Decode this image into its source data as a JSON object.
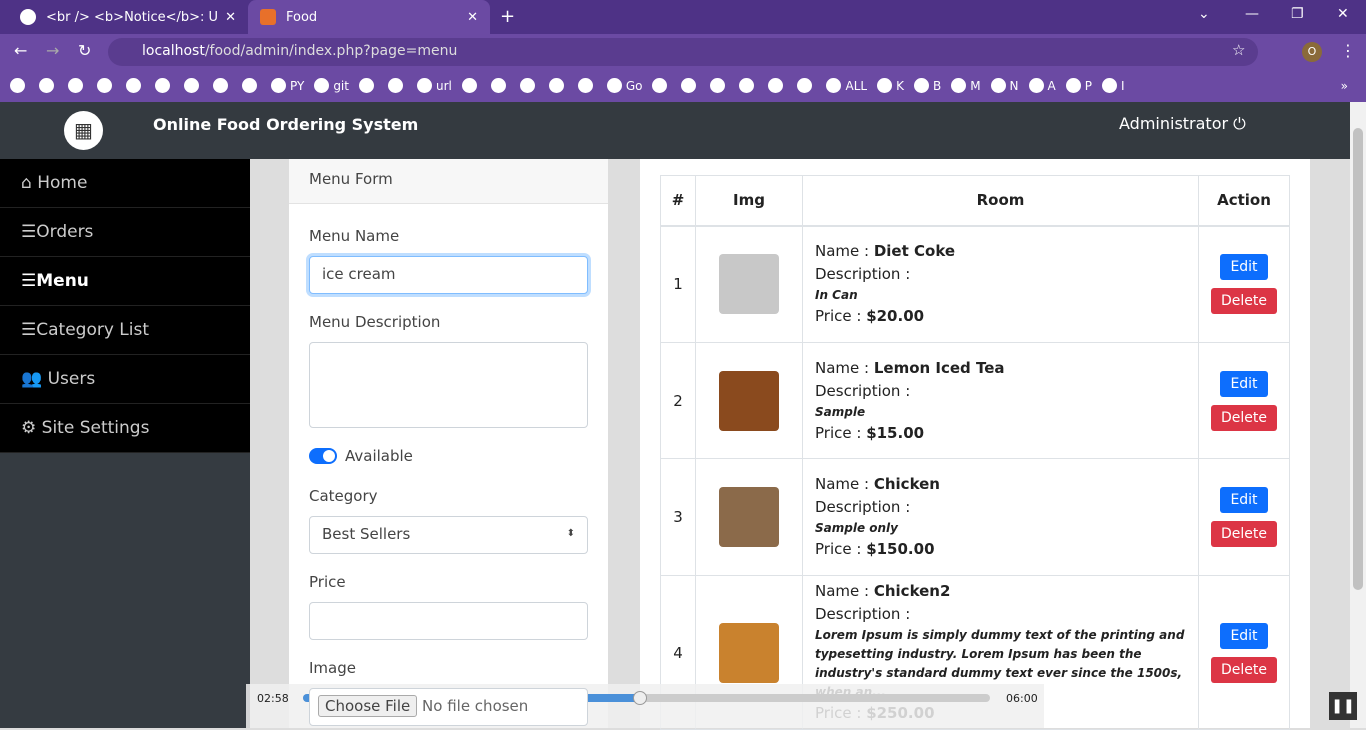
{
  "browser": {
    "tabs": [
      {
        "title": "<br /> <b>Notice</b>: Undefined",
        "icon": "globe-icon"
      },
      {
        "title": "Food",
        "icon": "xampp-icon",
        "active": true
      }
    ],
    "url_host": "localhost",
    "url_path": "/food/admin/index.php?page=menu",
    "bookmarks": [
      "",
      "",
      "",
      "",
      "",
      "",
      "",
      "",
      "",
      "PY",
      "git",
      "",
      "",
      "url",
      "",
      "",
      "",
      "",
      "",
      "Go",
      "",
      "",
      "",
      "",
      "",
      "",
      "ALL",
      "K",
      "B",
      "M",
      "N",
      "A",
      "P",
      "I"
    ]
  },
  "app": {
    "title": "Online Food Ordering System",
    "user": "Administrator"
  },
  "sidebar": {
    "items": [
      {
        "label": "Home",
        "icon": "home-icon"
      },
      {
        "label": "Orders",
        "icon": "list-icon"
      },
      {
        "label": "Menu",
        "icon": "list-icon",
        "active": true
      },
      {
        "label": "Category List",
        "icon": "list-icon"
      },
      {
        "label": "Users",
        "icon": "users-icon"
      },
      {
        "label": "Site Settings",
        "icon": "cogs-icon"
      }
    ]
  },
  "form": {
    "header": "Menu Form",
    "name_label": "Menu Name",
    "name_value": "ice cream",
    "desc_label": "Menu Description",
    "desc_value": "",
    "available_label": "Available",
    "available": true,
    "category_label": "Category",
    "category_value": "Best Sellers",
    "price_label": "Price",
    "price_value": "",
    "image_label": "Image",
    "file_button": "Choose File",
    "file_status": "No file chosen"
  },
  "table": {
    "headers": [
      "#",
      "Img",
      "Room",
      "Action"
    ],
    "name_label": "Name : ",
    "desc_label": "Description :",
    "price_label": "Price : ",
    "edit": "Edit",
    "delete": "Delete",
    "rows": [
      {
        "num": "1",
        "name": "Diet Coke",
        "description": "In Can",
        "price": "$20.00",
        "img_color": "#c8c8c8"
      },
      {
        "num": "2",
        "name": "Lemon Iced Tea",
        "description": "Sample",
        "price": "$15.00",
        "img_color": "#8a4a1e"
      },
      {
        "num": "3",
        "name": "Chicken",
        "description": "Sample only",
        "price": "$150.00",
        "img_color": "#8b6a4a"
      },
      {
        "num": "4",
        "name": "Chicken2",
        "description": "Lorem Ipsum is simply dummy text of the printing and typesetting industry. Lorem Ipsum has been the industry's standard dummy text ever since the 1500s, when an...",
        "price": "$250.00",
        "img_color": "#c9822e"
      }
    ]
  },
  "video": {
    "current": "02:58",
    "total": "06:00",
    "progress": 0.49
  }
}
